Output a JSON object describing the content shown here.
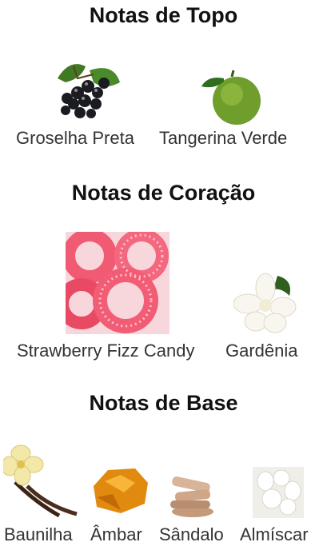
{
  "sections": [
    {
      "title": "Notas de Topo",
      "notes": [
        {
          "label": "Groselha Preta",
          "icon": "blackcurrant-icon"
        },
        {
          "label": "Tangerina Verde",
          "icon": "green-tangerine-icon"
        }
      ]
    },
    {
      "title": "Notas de Coração",
      "notes": [
        {
          "label": "Strawberry Fizz Candy",
          "icon": "strawberry-candy-icon"
        },
        {
          "label": "Gardênia",
          "icon": "gardenia-icon"
        }
      ]
    },
    {
      "title": "Notas de Base",
      "notes": [
        {
          "label": "Baunilha",
          "icon": "vanilla-icon"
        },
        {
          "label": "Âmbar",
          "icon": "amber-icon"
        },
        {
          "label": "Sândalo",
          "icon": "sandalwood-icon"
        },
        {
          "label": "Almíscar",
          "icon": "musk-icon"
        }
      ]
    }
  ]
}
